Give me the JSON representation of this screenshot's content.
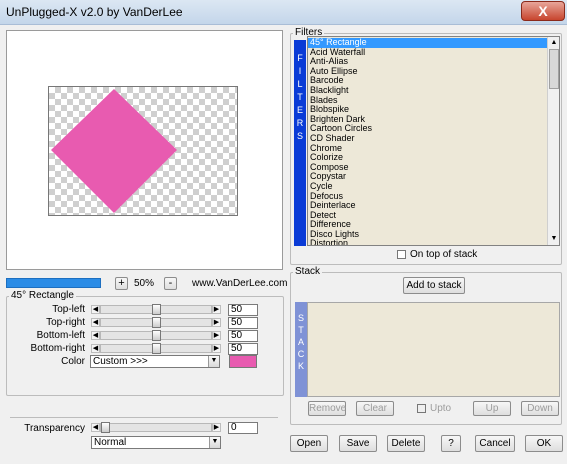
{
  "window": {
    "title": "UnPlugged-X v2.0 by VanDerLee",
    "close_label": "X"
  },
  "preview": {
    "shape_color": "#e85bb0",
    "checker_color": "#cfcfcf"
  },
  "zoom": {
    "progress": 1.0,
    "plus": "+",
    "minus": "-",
    "value": "50%",
    "website": "www.VanDerLee.com"
  },
  "params": {
    "group_label": "45° Rectangle",
    "rows": [
      {
        "label": "Top-left",
        "value": "50",
        "slider": 0.5
      },
      {
        "label": "Top-right",
        "value": "50",
        "slider": 0.5
      },
      {
        "label": "Bottom-left",
        "value": "50",
        "slider": 0.5
      },
      {
        "label": "Bottom-right",
        "value": "50",
        "slider": 0.5
      }
    ],
    "color_label": "Color",
    "color_option": "Custom >>>",
    "color_swatch": "#e85bb0"
  },
  "transparency": {
    "label": "Transparency",
    "value": "0",
    "blend_mode": "Normal"
  },
  "filters": {
    "group_label": "Filters",
    "strip_letters": [
      "F",
      "I",
      "L",
      "T",
      "E",
      "R",
      "S"
    ],
    "items": [
      "45° Rectangle",
      "Acid Waterfall",
      "Anti-Alias",
      "Auto Ellipse",
      "Barcode",
      "Blacklight",
      "Blades",
      "Blobspike",
      "Brighten Dark",
      "Cartoon Circles",
      "CD Shader",
      "Chrome",
      "Colorize",
      "Compose",
      "Copystar",
      "Cycle",
      "Defocus",
      "Deinterlace",
      "Detect",
      "Difference",
      "Disco Lights",
      "Distortion"
    ],
    "selected_index": 0,
    "on_top_label": "On top of stack"
  },
  "stack": {
    "group_label": "Stack",
    "add_label": "Add to stack",
    "strip_letters": [
      "S",
      "T",
      "A",
      "C",
      "K"
    ],
    "remove_label": "Remove",
    "clear_label": "Clear",
    "upto_label": "Upto",
    "up_label": "Up",
    "down_label": "Down"
  },
  "footer": {
    "open": "Open",
    "save": "Save",
    "delete": "Delete",
    "help": "?",
    "cancel": "Cancel",
    "ok": "OK"
  }
}
